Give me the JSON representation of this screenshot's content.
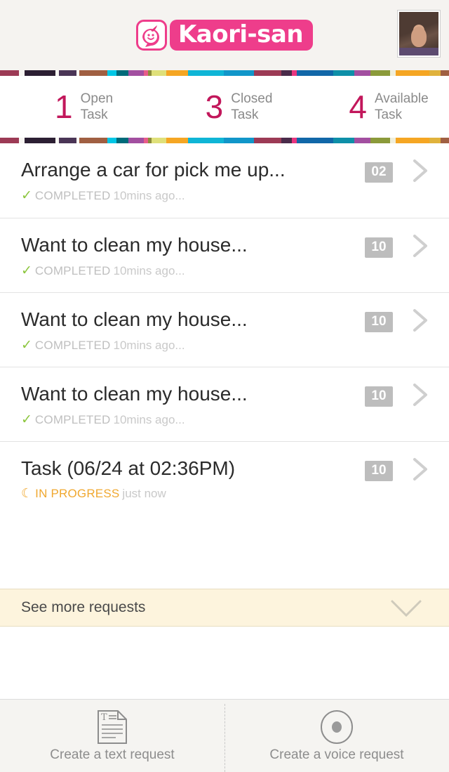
{
  "header": {
    "logo_text": "Kaori-san",
    "logo_mark_icon": "kaori-mascot-icon",
    "avatar_alt": "user-avatar",
    "brand_color": "#ee3d8b",
    "background": "#f5f3f0"
  },
  "stripe": {
    "colors": [
      "#9c3a55",
      "#f7f5f2",
      "#2c1f33",
      "#f7f5f2",
      "#4a3556",
      "#f7f5f2",
      "#a05f42",
      "#00c7e6",
      "#006b7a",
      "#a24fa0",
      "#e85c8a",
      "#8b8b3a",
      "#dfe07a",
      "#f5a623",
      "#0fb5d6",
      "#1196c9",
      "#9c3a55",
      "#4a2b4a",
      "#e8357f",
      "#1167a8",
      "#0e8fa8",
      "#a24fa0",
      "#8b9a3a",
      "#f0efdc",
      "#f5a623",
      "#e0b23c",
      "#a05f42"
    ]
  },
  "stats": [
    {
      "number": "1",
      "label_line1": "Open",
      "label_line2": "Task"
    },
    {
      "number": "3",
      "label_line1": "Closed",
      "label_line2": "Task"
    },
    {
      "number": "4",
      "label_line1": "Available",
      "label_line2": "Task"
    }
  ],
  "stat_number_color": "#c2175b",
  "tasks": [
    {
      "title": "Arrange a car for pick me up...",
      "status": "COMPLETED",
      "status_type": "completed",
      "status_icon": "check-icon",
      "time": "10mins ago...",
      "badge": "02"
    },
    {
      "title": "Want to clean my house...",
      "status": "COMPLETED",
      "status_type": "completed",
      "status_icon": "check-icon",
      "time": "10mins ago...",
      "badge": "10"
    },
    {
      "title": "Want to clean my house...",
      "status": "COMPLETED",
      "status_type": "completed",
      "status_icon": "check-icon",
      "time": "10mins ago...",
      "badge": "10"
    },
    {
      "title": "Want to clean my house...",
      "status": "COMPLETED",
      "status_type": "completed",
      "status_icon": "check-icon",
      "time": "10mins ago...",
      "badge": "10"
    },
    {
      "title": "Task (06/24 at 02:36PM)",
      "status": "IN PROGRESS",
      "status_type": "progress",
      "status_icon": "spinner-icon",
      "time": "just now",
      "badge": "10"
    }
  ],
  "task_colors": {
    "completed": "#bfbfbf",
    "check": "#8cc63e",
    "progress": "#f0a830",
    "badge_bg": "#bdbdbd"
  },
  "see_more": {
    "label": "See more requests",
    "chevron_icon": "chevron-down-icon",
    "background": "#fdf4dd"
  },
  "bottom_bar": [
    {
      "label": "Create a text request",
      "icon": "text-document-icon"
    },
    {
      "label": "Create a voice request",
      "icon": "microphone-record-icon"
    }
  ]
}
